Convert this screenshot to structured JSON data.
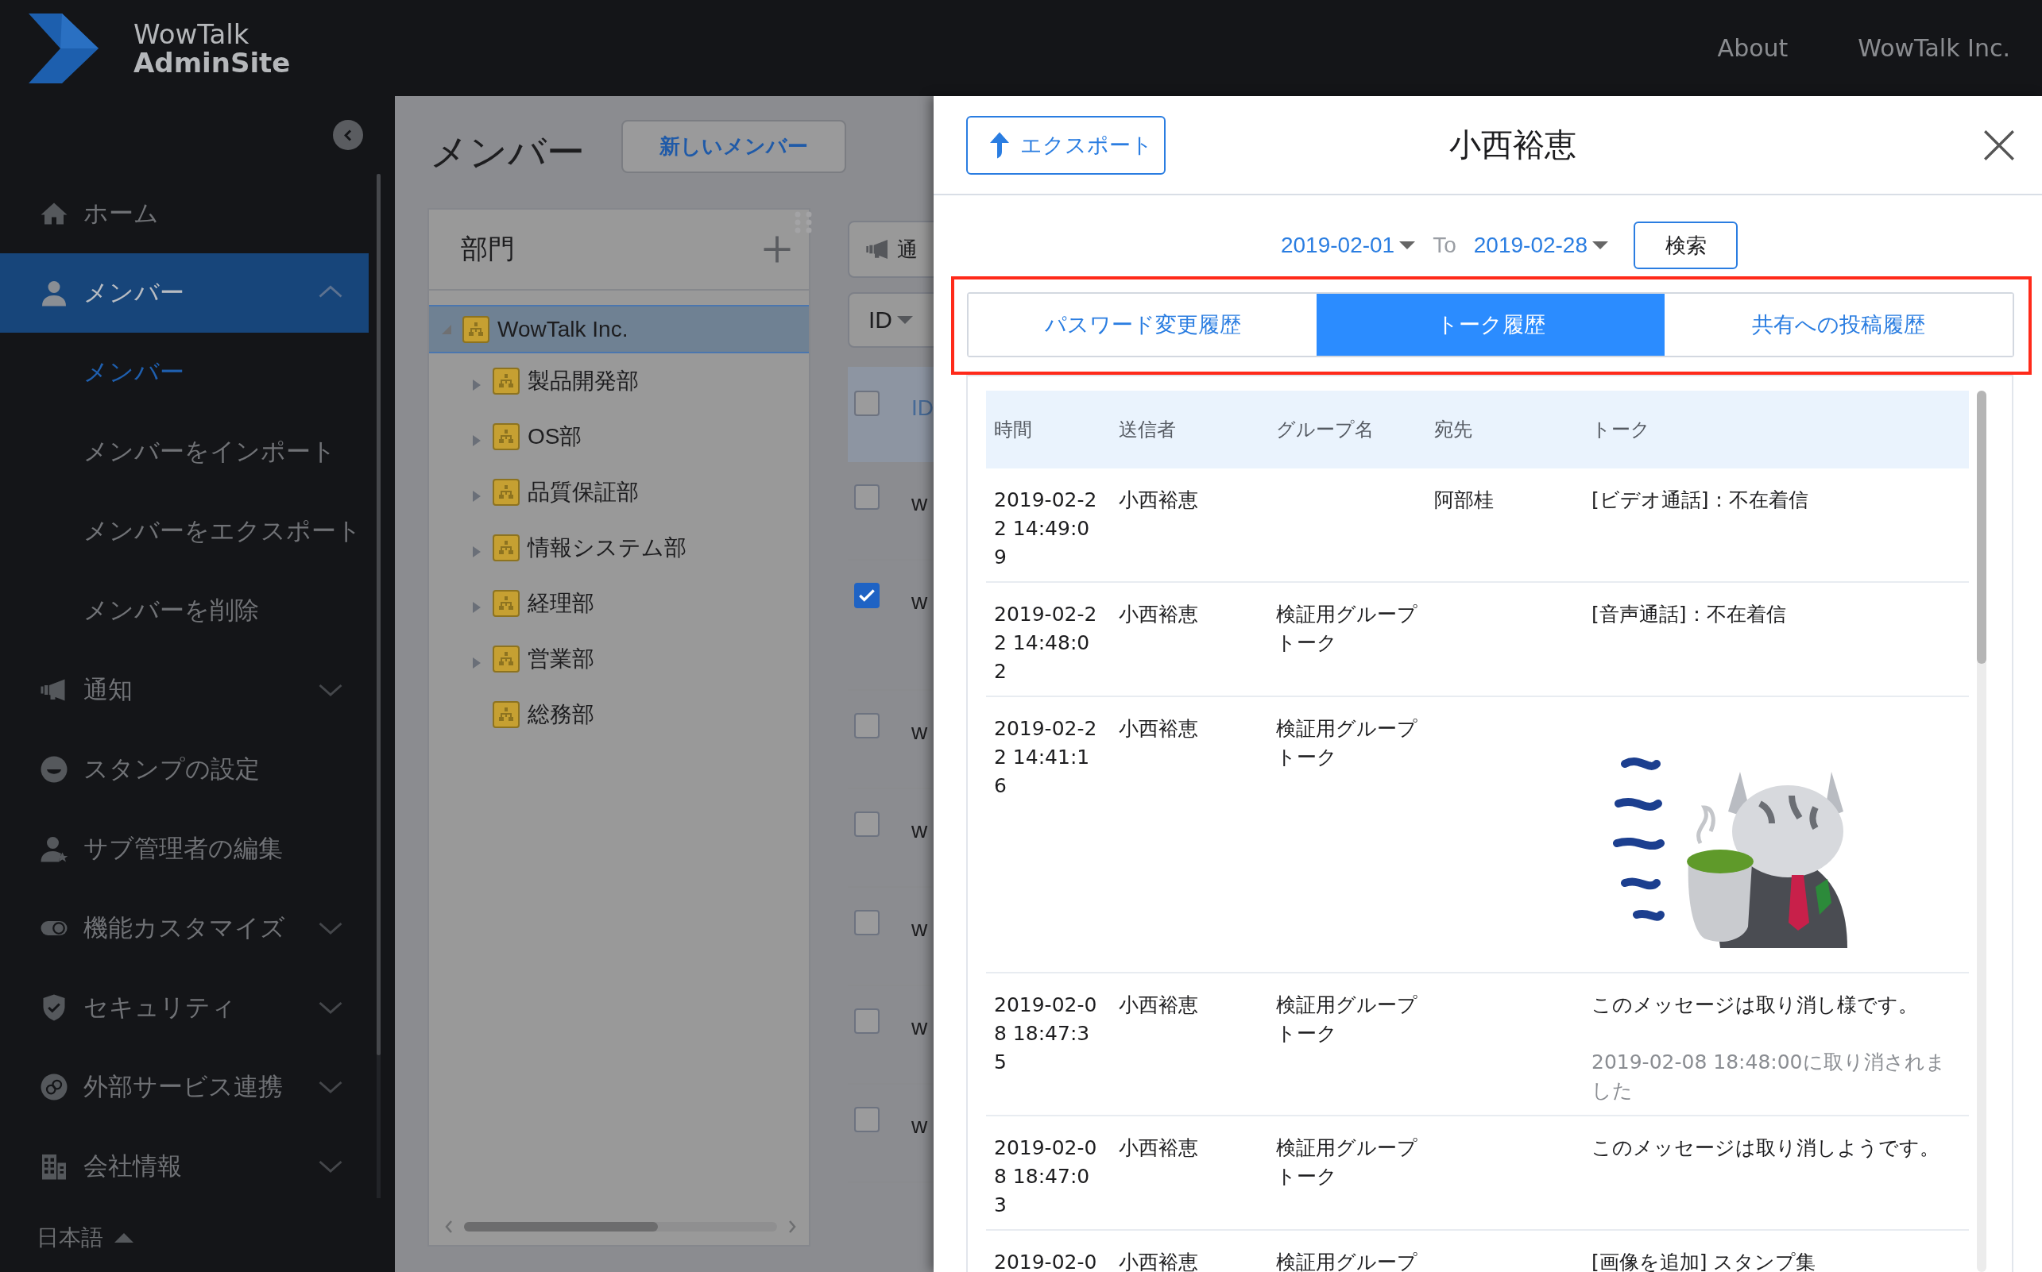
{
  "topbar": {
    "logo": {
      "line_1": "WowTalk",
      "line_2": "AdminSite"
    },
    "links": [
      "About",
      "WowTalk Inc."
    ]
  },
  "sidebar": {
    "items": [
      {
        "label": "ホーム",
        "kind": "link",
        "selected": false
      },
      {
        "label": "メンバー",
        "kind": "group",
        "selected": true,
        "expanded": true,
        "children": [
          {
            "label": "メンバー",
            "selected": true
          },
          {
            "label": "メンバーをインポート",
            "selected": false
          },
          {
            "label": "メンバーをエクスポート",
            "selected": false
          },
          {
            "label": "メンバーを削除",
            "selected": false
          }
        ]
      },
      {
        "label": "通知",
        "kind": "group",
        "selected": false,
        "expanded": false
      },
      {
        "label": "スタンプの設定",
        "kind": "link",
        "selected": false
      },
      {
        "label": "サブ管理者の編集",
        "kind": "link",
        "selected": false
      },
      {
        "label": "機能カスタマイズ",
        "kind": "group",
        "selected": false,
        "expanded": false
      },
      {
        "label": "セキュリティ",
        "kind": "group",
        "selected": false,
        "expanded": false
      },
      {
        "label": "外部サービス連携",
        "kind": "group",
        "selected": false,
        "expanded": false
      },
      {
        "label": "会社情報",
        "kind": "group",
        "selected": false,
        "expanded": false
      }
    ],
    "language": "日本語"
  },
  "main": {
    "title": "メンバー",
    "new_button": "新しいメンバー",
    "departments": {
      "title": "部門",
      "tree": [
        {
          "label": "WowTalk Inc.",
          "kind": "branch",
          "selected": true,
          "expanded": true,
          "children": [
            {
              "label": "製品開発部",
              "kind": "branch",
              "selected": false,
              "expanded": false
            },
            {
              "label": "OS部",
              "kind": "branch",
              "selected": false,
              "expanded": false
            },
            {
              "label": "品質保証部",
              "kind": "branch",
              "selected": false,
              "expanded": false
            },
            {
              "label": "情報システム部",
              "kind": "branch",
              "selected": false,
              "expanded": false
            },
            {
              "label": "経理部",
              "kind": "branch",
              "selected": false,
              "expanded": false
            },
            {
              "label": "営業部",
              "kind": "branch",
              "selected": false,
              "expanded": false
            },
            {
              "label": "総務部",
              "kind": "leaf",
              "selected": false
            }
          ]
        }
      ]
    },
    "members": {
      "notify_button": "通",
      "sort_button": "ID",
      "select_all_checked": false,
      "columns": [
        "ID"
      ],
      "rows": [
        {
          "checked": false,
          "column_1": "w"
        },
        {
          "checked": true,
          "column_1": "w"
        },
        {
          "checked": false,
          "column_1": "w"
        },
        {
          "checked": false,
          "column_1": "w"
        },
        {
          "checked": false,
          "column_1": "w"
        },
        {
          "checked": false,
          "column_1": "w"
        },
        {
          "checked": false,
          "column_1": "w"
        }
      ]
    }
  },
  "drawer": {
    "export_button": "エクスポート",
    "title": "小西裕恵",
    "date_from": "2019-02-01",
    "to_label": "To",
    "date_to": "2019-02-28",
    "search_button": "検索",
    "tabs_highlighted": true,
    "tabs": [
      {
        "label": "パスワード変更履歴",
        "selected": false
      },
      {
        "label": "トーク履歴",
        "selected": true
      },
      {
        "label": "共有への投稿履歴",
        "selected": false
      }
    ],
    "table": {
      "columns": [
        "時間",
        "送信者",
        "グループ名",
        "宛先",
        "トーク"
      ],
      "rows": [
        {
          "time": "2019-02-22 14:49:09",
          "sender": "小西裕恵",
          "group": "",
          "to": "阿部桂",
          "kind": "text",
          "talk": "[ビデオ通話]：不在着信"
        },
        {
          "time": "2019-02-22 14:48:02",
          "sender": "小西裕恵",
          "group": "検証用グループトーク",
          "to": "",
          "kind": "text",
          "talk": "[音声通話]：不在着信"
        },
        {
          "time": "2019-02-22 14:41:16",
          "sender": "小西裕恵",
          "group": "検証用グループトーク",
          "to": "",
          "kind": "picture"
        },
        {
          "time": "2019-02-08 18:47:35",
          "sender": "小西裕恵",
          "group": "検証用グループトーク",
          "to": "",
          "kind": "text",
          "talk": "このメッセージは取り消し様です。",
          "note": "2019-02-08 18:48:00に取り消されました"
        },
        {
          "time": "2019-02-08 18:47:03",
          "sender": "小西裕恵",
          "group": "検証用グループトーク",
          "to": "",
          "kind": "text",
          "talk": "このメッセージは取り消しようです。"
        },
        {
          "time": "2019-02-0",
          "sender": "小西裕恵",
          "group": "検証用グループ",
          "to": "",
          "kind": "text",
          "talk": "[画像を追加] スタンプ集"
        }
      ]
    }
  }
}
